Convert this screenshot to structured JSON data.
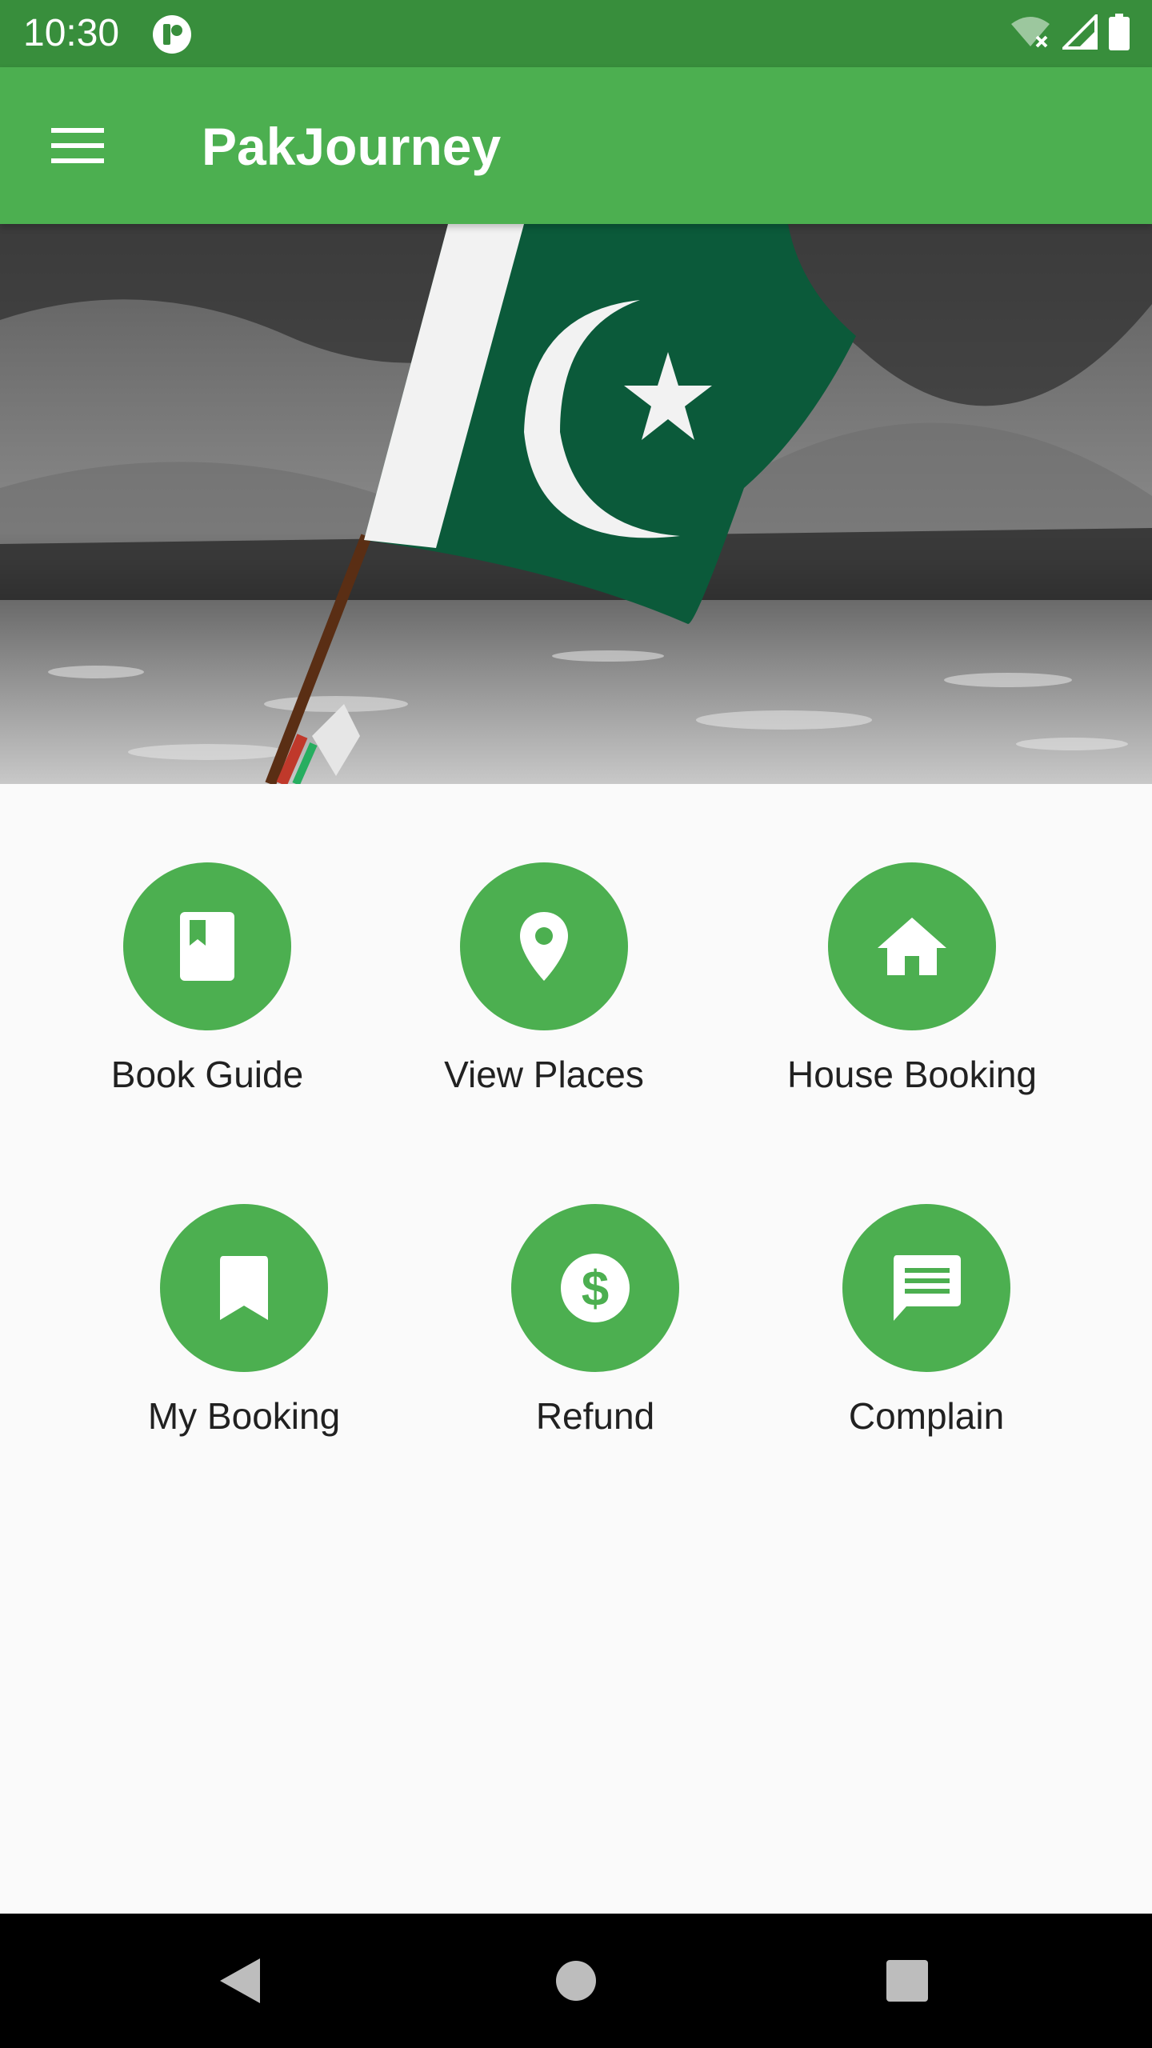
{
  "status_bar": {
    "time": "10:30",
    "icons": [
      "app-notification-icon",
      "wifi-off-icon",
      "signal-icon",
      "battery-icon"
    ]
  },
  "app_bar": {
    "title": "PakJourney",
    "menu_icon": "hamburger-menu-icon"
  },
  "hero": {
    "image": "pakistan-flag-over-river"
  },
  "menu": {
    "items": [
      {
        "label": "Book Guide",
        "icon": "book-icon"
      },
      {
        "label": "View Places",
        "icon": "location-pin-icon"
      },
      {
        "label": "House Booking",
        "icon": "home-icon"
      },
      {
        "label": "My Booking",
        "icon": "bookmark-icon"
      },
      {
        "label": "Refund",
        "icon": "dollar-icon"
      },
      {
        "label": "Complain",
        "icon": "message-icon"
      }
    ]
  },
  "nav_bar": {
    "buttons": [
      "back-icon",
      "home-circle-icon",
      "recents-icon"
    ]
  },
  "colors": {
    "primary": "#4caf50",
    "primary_dark": "#388e3c",
    "background": "#fafafa",
    "flag_green": "#0b5a3a"
  }
}
